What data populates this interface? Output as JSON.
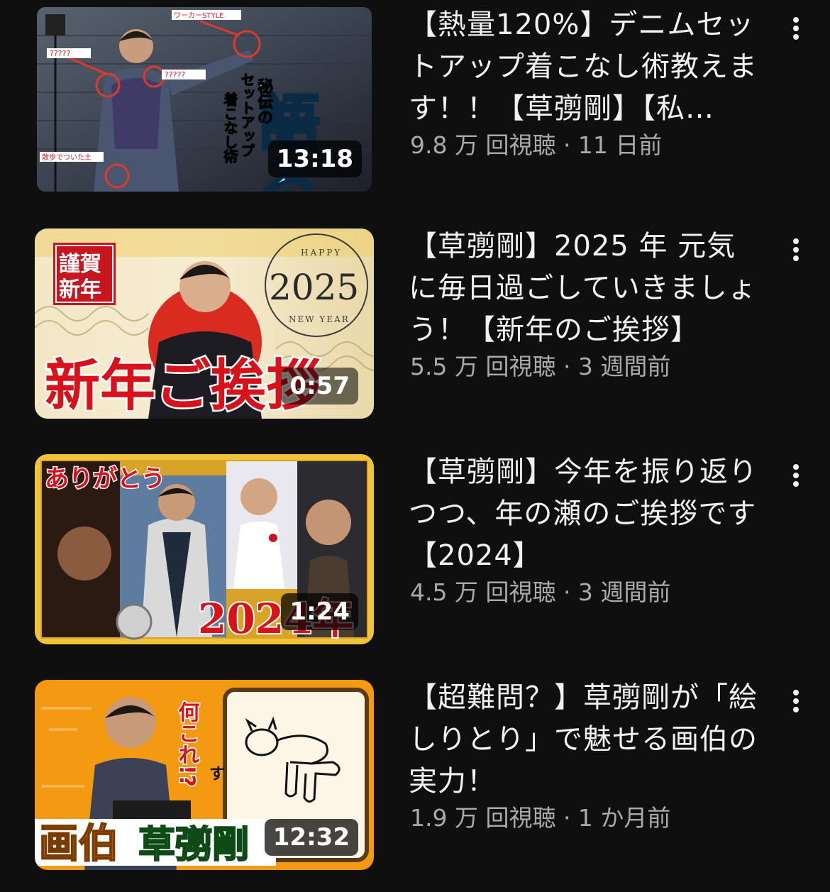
{
  "videos": [
    {
      "title": "【熱量120%】デニムセットアップ着こなし術教えます！！【草彅剛】【私…",
      "meta": "9.8 万 回視聴 · 11 日前",
      "duration": "13:18",
      "thumb_text": {
        "big": "語る",
        "sub1": "秘伝の",
        "sub2": "セットアップ",
        "sub3": "着こなし術",
        "callout1": "ワーカーSTYLE",
        "callout2": "?????",
        "callout3": "?????",
        "callout4": "散歩でついた土"
      }
    },
    {
      "title": "【草彅剛】2025 年 元気に毎日過ごしていきましょう！【新年のご挨拶】",
      "meta": "5.5 万 回視聴 · 3 週間前",
      "duration": "0:57",
      "thumb_text": {
        "badge": "謹賀新年",
        "happy": "HAPPY",
        "year": "2025",
        "newyear": "NEW YEAR",
        "big": "新年ご挨拶"
      }
    },
    {
      "title": "【草彅剛】今年を振り返りつつ、年の瀬のご挨拶です【2024】",
      "meta": "4.5 万 回視聴 · 3 週間前",
      "duration": "1:24",
      "thumb_text": {
        "top": "ありがとう",
        "year": "2024年"
      }
    },
    {
      "title": "【超難問？】草彅剛が「絵しりとり」で魅せる画伯の実力！",
      "meta": "1.9 万 回視聴 · 1 か月前",
      "duration": "12:32",
      "thumb_text": {
        "label1": "画伯",
        "label2": "草彅剛",
        "what": "何これ!?",
        "su": "す"
      }
    }
  ],
  "icons": {
    "more": "kebab-vertical-icon"
  },
  "colors": {
    "background": "#0f0f0f",
    "title": "#f1f1f1",
    "meta": "#aaaaaa"
  }
}
